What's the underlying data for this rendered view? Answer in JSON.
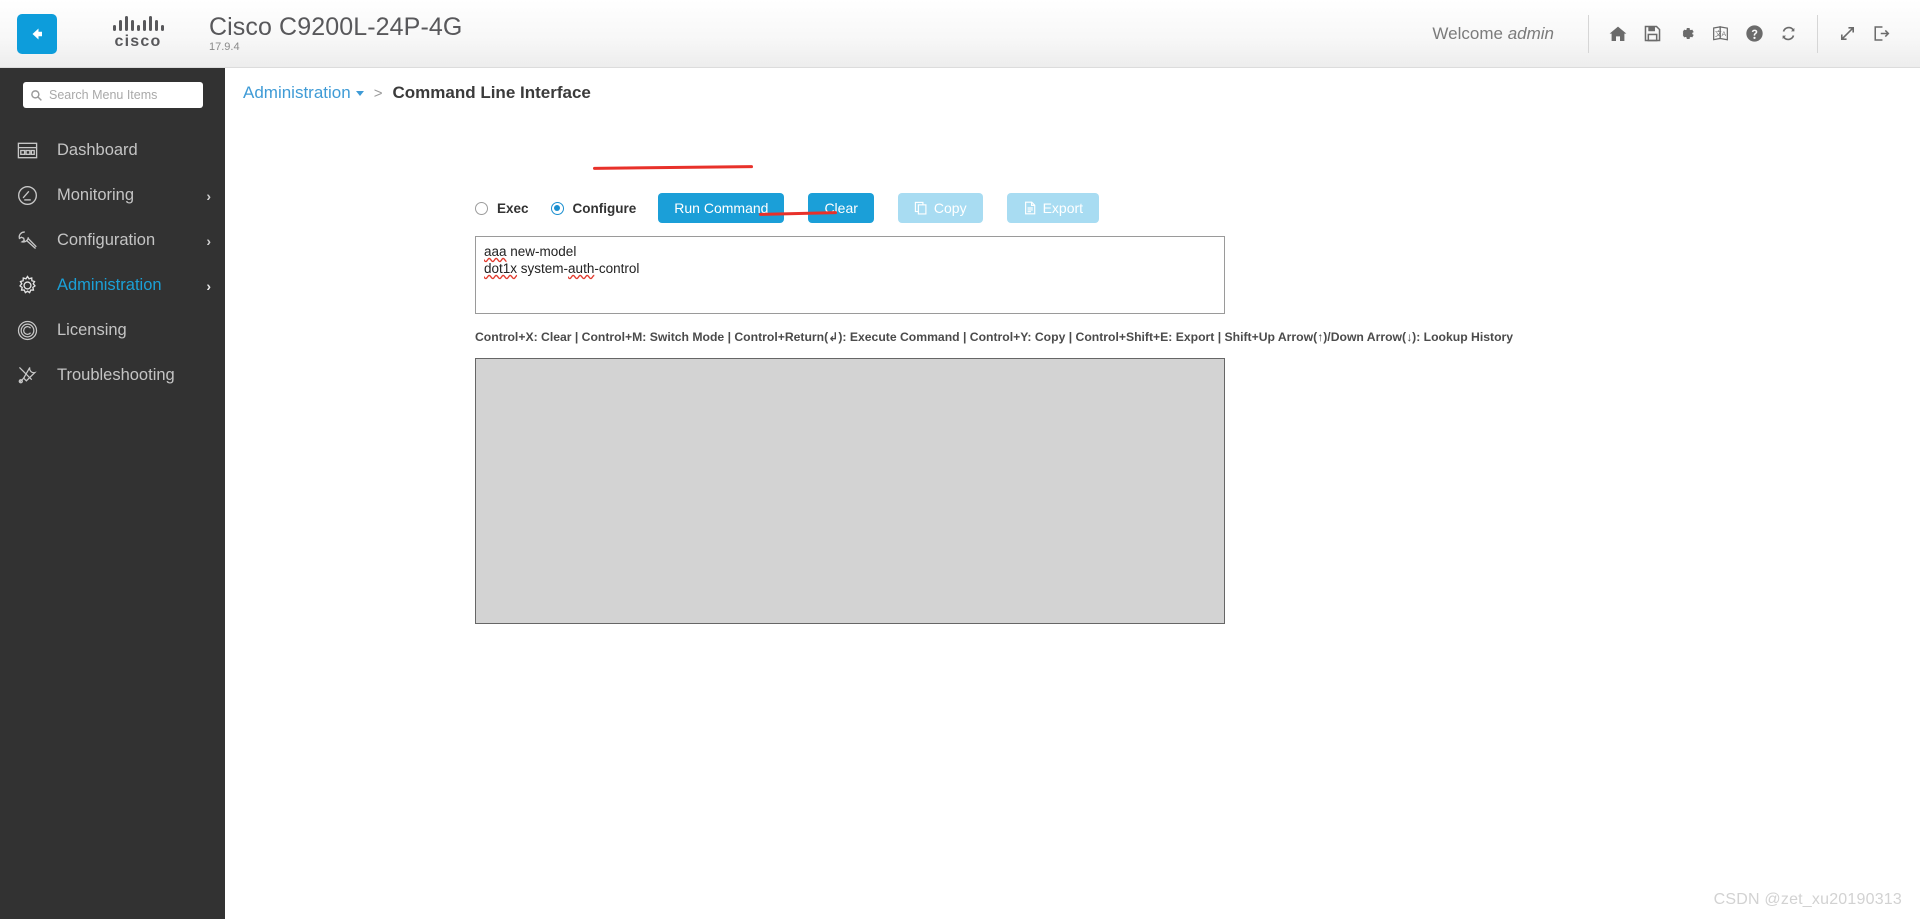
{
  "header": {
    "back_button": "back-arrow",
    "brand": "cisco",
    "device_title": "Cisco C9200L-24P-4G",
    "device_version": "17.9.4",
    "welcome_prefix": "Welcome",
    "welcome_user": "admin",
    "icons": [
      {
        "name": "home-icon",
        "title": "Home"
      },
      {
        "name": "save-icon",
        "title": "Save Configuration"
      },
      {
        "name": "gear-icon",
        "title": "Settings"
      },
      {
        "name": "translate-icon",
        "title": "Language"
      },
      {
        "name": "help-icon",
        "title": "Help"
      },
      {
        "name": "refresh-icon",
        "title": "Refresh"
      },
      {
        "name": "expand-icon",
        "title": "Full Screen"
      },
      {
        "name": "logout-icon",
        "title": "Log Out"
      }
    ]
  },
  "sidebar": {
    "search": {
      "placeholder": "Search Menu Items",
      "value": ""
    },
    "items": [
      {
        "label": "Dashboard",
        "icon": "dashboard-icon",
        "has_chevron": false,
        "active": false
      },
      {
        "label": "Monitoring",
        "icon": "monitoring-icon",
        "has_chevron": true,
        "active": false
      },
      {
        "label": "Configuration",
        "icon": "wrench-icon",
        "has_chevron": true,
        "active": false
      },
      {
        "label": "Administration",
        "icon": "gear-outline-icon",
        "has_chevron": true,
        "active": true
      },
      {
        "label": "Licensing",
        "icon": "copyright-icon",
        "has_chevron": false,
        "active": false
      },
      {
        "label": "Troubleshooting",
        "icon": "troubleshooting-icon",
        "has_chevron": false,
        "active": false
      }
    ]
  },
  "breadcrumb": {
    "parent": "Administration",
    "separator": ">",
    "current": "Command Line Interface"
  },
  "cli": {
    "modes": [
      {
        "label": "Exec",
        "selected": false
      },
      {
        "label": "Configure",
        "selected": true
      }
    ],
    "buttons": [
      {
        "label": "Run Command",
        "state": "enabled",
        "icon": null
      },
      {
        "label": "Clear",
        "state": "enabled",
        "icon": null
      },
      {
        "label": "Copy",
        "state": "disabled",
        "icon": "copy-icon"
      },
      {
        "label": "Export",
        "state": "disabled",
        "icon": "export-icon"
      }
    ],
    "command_lines": [
      {
        "prefix": "aaa",
        "suffix": " new-model",
        "misspelled_suffix": ""
      },
      {
        "prefix": "dot1x",
        "suffix": " system-",
        "misspelled_suffix": "auth",
        "tail": "-control"
      }
    ],
    "command_text": "aaa new-model\ndot1x system-auth-control",
    "hint": "Control+X: Clear | Control+M: Switch Mode | Control+Return(↲): Execute Command | Control+Y: Copy | Control+Shift+E: Export | Shift+Up Arrow(↑)/Down Arrow(↓): Lookup History",
    "output": ""
  },
  "watermark": "CSDN @zet_xu20190313",
  "colors": {
    "accent": "#1b9fd8",
    "accent_disabled": "#a8dcf2",
    "sidebar_bg": "#323232",
    "link": "#3f9bd6",
    "annotation_red": "#e8312a",
    "output_bg": "#d3d3d3"
  }
}
